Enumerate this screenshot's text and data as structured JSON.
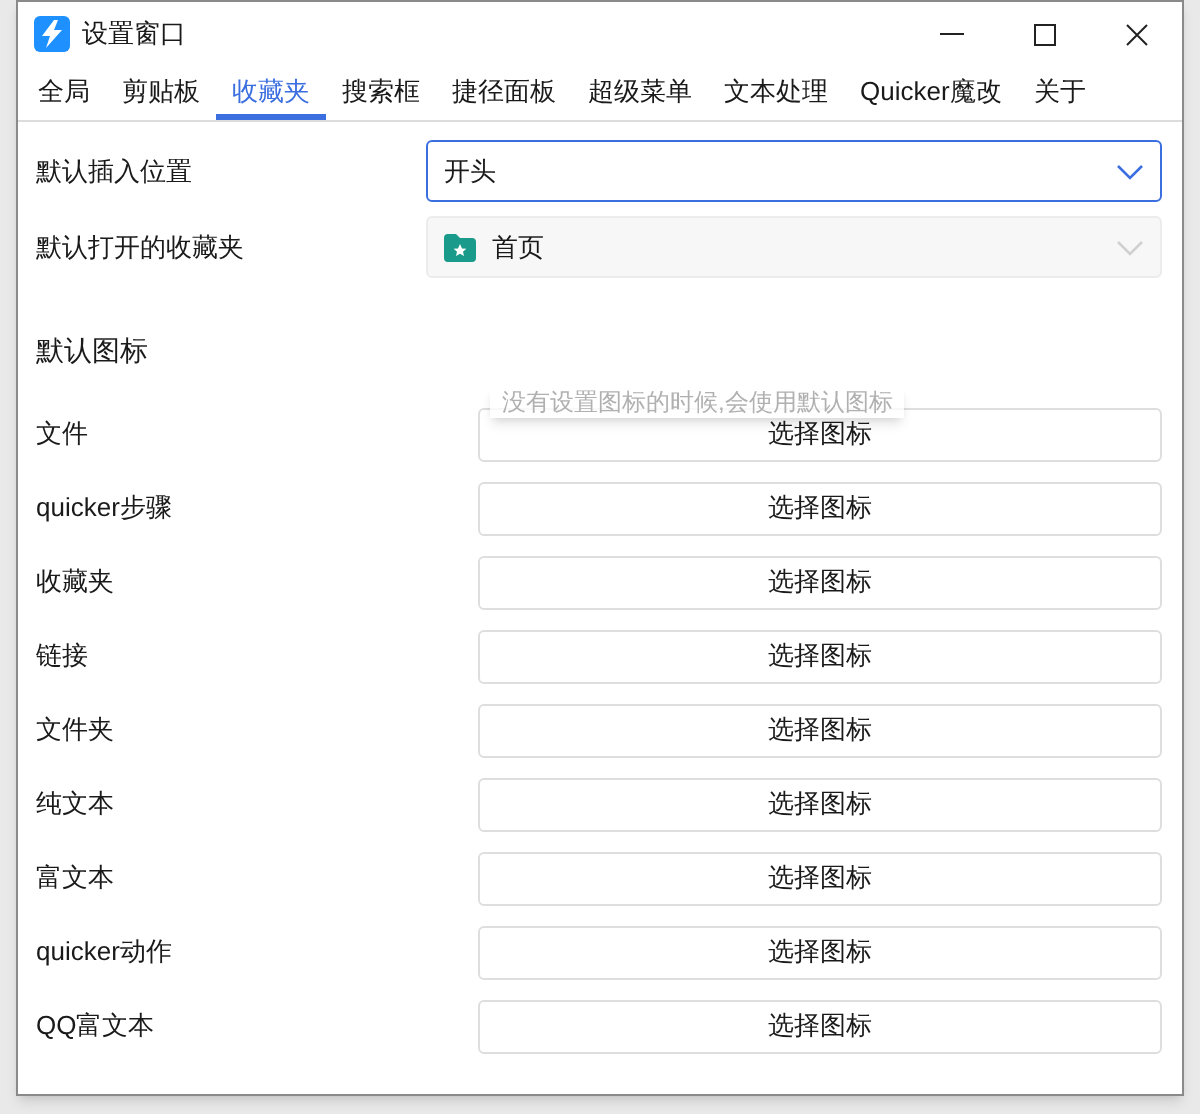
{
  "window": {
    "title": "设置窗口"
  },
  "tabs": [
    {
      "label": "全局",
      "selected": false
    },
    {
      "label": "剪贴板",
      "selected": false
    },
    {
      "label": "收藏夹",
      "selected": true
    },
    {
      "label": "搜索框",
      "selected": false
    },
    {
      "label": "捷径面板",
      "selected": false
    },
    {
      "label": "超级菜单",
      "selected": false
    },
    {
      "label": "文本处理",
      "selected": false
    },
    {
      "label": "Quicker魔改",
      "selected": false
    },
    {
      "label": "关于",
      "selected": false
    }
  ],
  "settings": [
    {
      "label": "默认插入位置",
      "value": "开头",
      "focused": true,
      "folder_icon": false
    },
    {
      "label": "默认打开的收藏夹",
      "value": "首页",
      "focused": false,
      "folder_icon": true
    }
  ],
  "icons_section": {
    "heading": "默认图标",
    "tooltip": "没有设置图标的时候,会使用默认图标",
    "rows": [
      {
        "label": "文件",
        "button": "选择图标"
      },
      {
        "label": "quicker步骤",
        "button": "选择图标"
      },
      {
        "label": "收藏夹",
        "button": "选择图标"
      },
      {
        "label": "链接",
        "button": "选择图标"
      },
      {
        "label": "文件夹",
        "button": "选择图标"
      },
      {
        "label": "纯文本",
        "button": "选择图标"
      },
      {
        "label": "富文本",
        "button": "选择图标"
      },
      {
        "label": "quicker动作",
        "button": "选择图标"
      },
      {
        "label": "QQ富文本",
        "button": "选择图标"
      }
    ]
  }
}
